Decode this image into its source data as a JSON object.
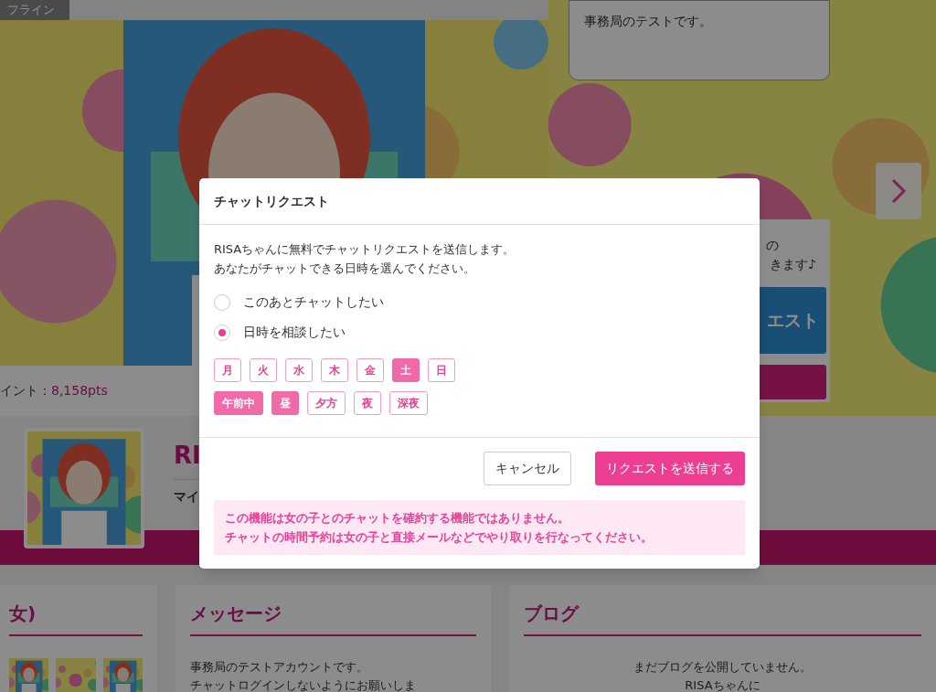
{
  "background": {
    "status_tag": "フライン",
    "points": {
      "label": "イント：",
      "value": "8,158pts"
    },
    "speech_bubble": "事務局のテストです。",
    "side_card": {
      "line_1": "の",
      "line_2": "きます♪",
      "button": "エスト"
    },
    "profile": {
      "name": "RI",
      "sub": "マイ"
    },
    "cards": [
      {
        "title": "女)",
        "kind": "thumbs"
      },
      {
        "title": "メッセージ",
        "kind": "text",
        "lines": [
          "事務局のテストアカウントです。",
          "チャットログインしないようにお願いしま"
        ]
      },
      {
        "title": "ブログ",
        "kind": "centered_text",
        "lines": [
          "まだブログを公開していません。",
          "RISAちゃんに"
        ]
      }
    ]
  },
  "dialog": {
    "title": "チャットリクエスト",
    "intro": [
      "RISAちゃんに無料でチャットリクエストを送信します。",
      "あなたがチャットできる日時を選んでください。"
    ],
    "options": [
      {
        "label": "このあとチャットしたい",
        "selected": false
      },
      {
        "label": "日時を相談したい",
        "selected": true
      }
    ],
    "days": [
      {
        "label": "月",
        "selected": false
      },
      {
        "label": "火",
        "selected": false
      },
      {
        "label": "水",
        "selected": false
      },
      {
        "label": "木",
        "selected": false
      },
      {
        "label": "金",
        "selected": false
      },
      {
        "label": "土",
        "selected": true
      },
      {
        "label": "日",
        "selected": false
      }
    ],
    "times": [
      {
        "label": "午前中",
        "selected": true
      },
      {
        "label": "昼",
        "selected": true
      },
      {
        "label": "夕方",
        "selected": false
      },
      {
        "label": "夜",
        "selected": false
      },
      {
        "label": "深夜",
        "selected": false
      }
    ],
    "cancel": "キャンセル",
    "submit": "リクエストを送信する",
    "notice": [
      "この機能は女の子とのチャットを確約する機能ではありません。",
      "チャットの時間予約は女の子と直接メールなどでやり取りを行なってください。"
    ]
  }
}
